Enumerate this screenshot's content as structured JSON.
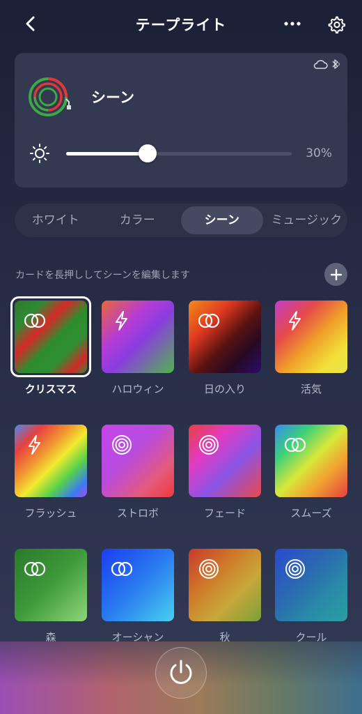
{
  "header": {
    "title": "テープライト",
    "back_icon": "chevron-left-icon",
    "more_icon": "more-horizontal-icon",
    "settings_icon": "gear-icon"
  },
  "device": {
    "name": "シーン",
    "status_icons": [
      "cloud-icon",
      "bluetooth-icon"
    ],
    "brightness_value": "30%",
    "brightness_fraction": 0.3
  },
  "tabs": [
    {
      "label": "ホワイト",
      "active": false
    },
    {
      "label": "カラー",
      "active": false
    },
    {
      "label": "シーン",
      "active": true
    },
    {
      "label": "ミュージック",
      "active": false
    }
  ],
  "hint": "カードを長押ししてシーンを編集します",
  "scenes": [
    {
      "label": "クリスマス",
      "icon": "rings-icon",
      "selected": true,
      "gradient": "linear-gradient(135deg,#2d7a2d 0%,#2e8a32 20%,#d62a2a 38%,#2d8d2d 55%,#2f8e33 72%,#d22a2a 88%,#2e8a30 100%)"
    },
    {
      "label": "ハロウィン",
      "icon": "lightning-icon",
      "selected": false,
      "gradient": "linear-gradient(135deg,#e8673a 0%,#b53bd6 35%,#8a3de0 55%,#4fb54a 100%)"
    },
    {
      "label": "日の入り",
      "icon": "rings-icon",
      "selected": false,
      "gradient": "linear-gradient(135deg,#f58a1e 0%,#e0391f 30%,#5a1212 55%,#270a20 75%,#2a0c6a 100%)"
    },
    {
      "label": "活気",
      "icon": "lightning-icon",
      "selected": false,
      "gradient": "linear-gradient(135deg,#c43cc8 0%,#e64a4a 30%,#f0a02a 55%,#f3e03a 80%,#e7e54a 100%)"
    },
    {
      "label": "フラッシュ",
      "icon": "lightning-icon",
      "selected": false,
      "gradient": "linear-gradient(135deg,#4a8af0 0%,#e64040 20%,#f09a30 40%,#f2ea30 55%,#5ad24a 72%,#3a7df0 88%,#a34ee8 100%)"
    },
    {
      "label": "ストロボ",
      "icon": "concentric-circles-icon",
      "selected": false,
      "gradient": "linear-gradient(135deg,#c845e8 0%,#b74be0 40%,#e45a7a 75%,#ee3a3a 100%)"
    },
    {
      "label": "フェード",
      "icon": "concentric-circles-icon",
      "selected": false,
      "gradient": "linear-gradient(135deg,#e6403e 0%,#e33ac2 30%,#8a55e6 60%,#e84a4a 100%)"
    },
    {
      "label": "スムーズ",
      "icon": "rings-icon",
      "selected": false,
      "gradient": "linear-gradient(135deg,#3a8cf0 0%,#3ad07a 25%,#d8e83a 50%,#f0a030 72%,#e64040 100%)"
    },
    {
      "label": "森",
      "icon": "rings-icon",
      "selected": false,
      "gradient": "linear-gradient(135deg,#2a7a2a 0%,#3e9a3a 50%,#8fd678 100%)"
    },
    {
      "label": "オーシャン",
      "icon": "rings-icon",
      "selected": false,
      "gradient": "linear-gradient(135deg,#1a3ef0 0%,#2a7af0 50%,#4ad0f0 100%)"
    },
    {
      "label": "秋",
      "icon": "concentric-circles-icon",
      "selected": false,
      "gradient": "linear-gradient(135deg,#c83a2a 0%,#d0782a 35%,#c8a83a 65%,#7aa03a 100%)"
    },
    {
      "label": "クール",
      "icon": "concentric-circles-icon",
      "selected": false,
      "gradient": "linear-gradient(135deg,#2a4ad0 0%,#2a6ab0 40%,#2a8aa8 70%,#2aa0a0 100%)"
    }
  ],
  "power_icon": "power-icon"
}
